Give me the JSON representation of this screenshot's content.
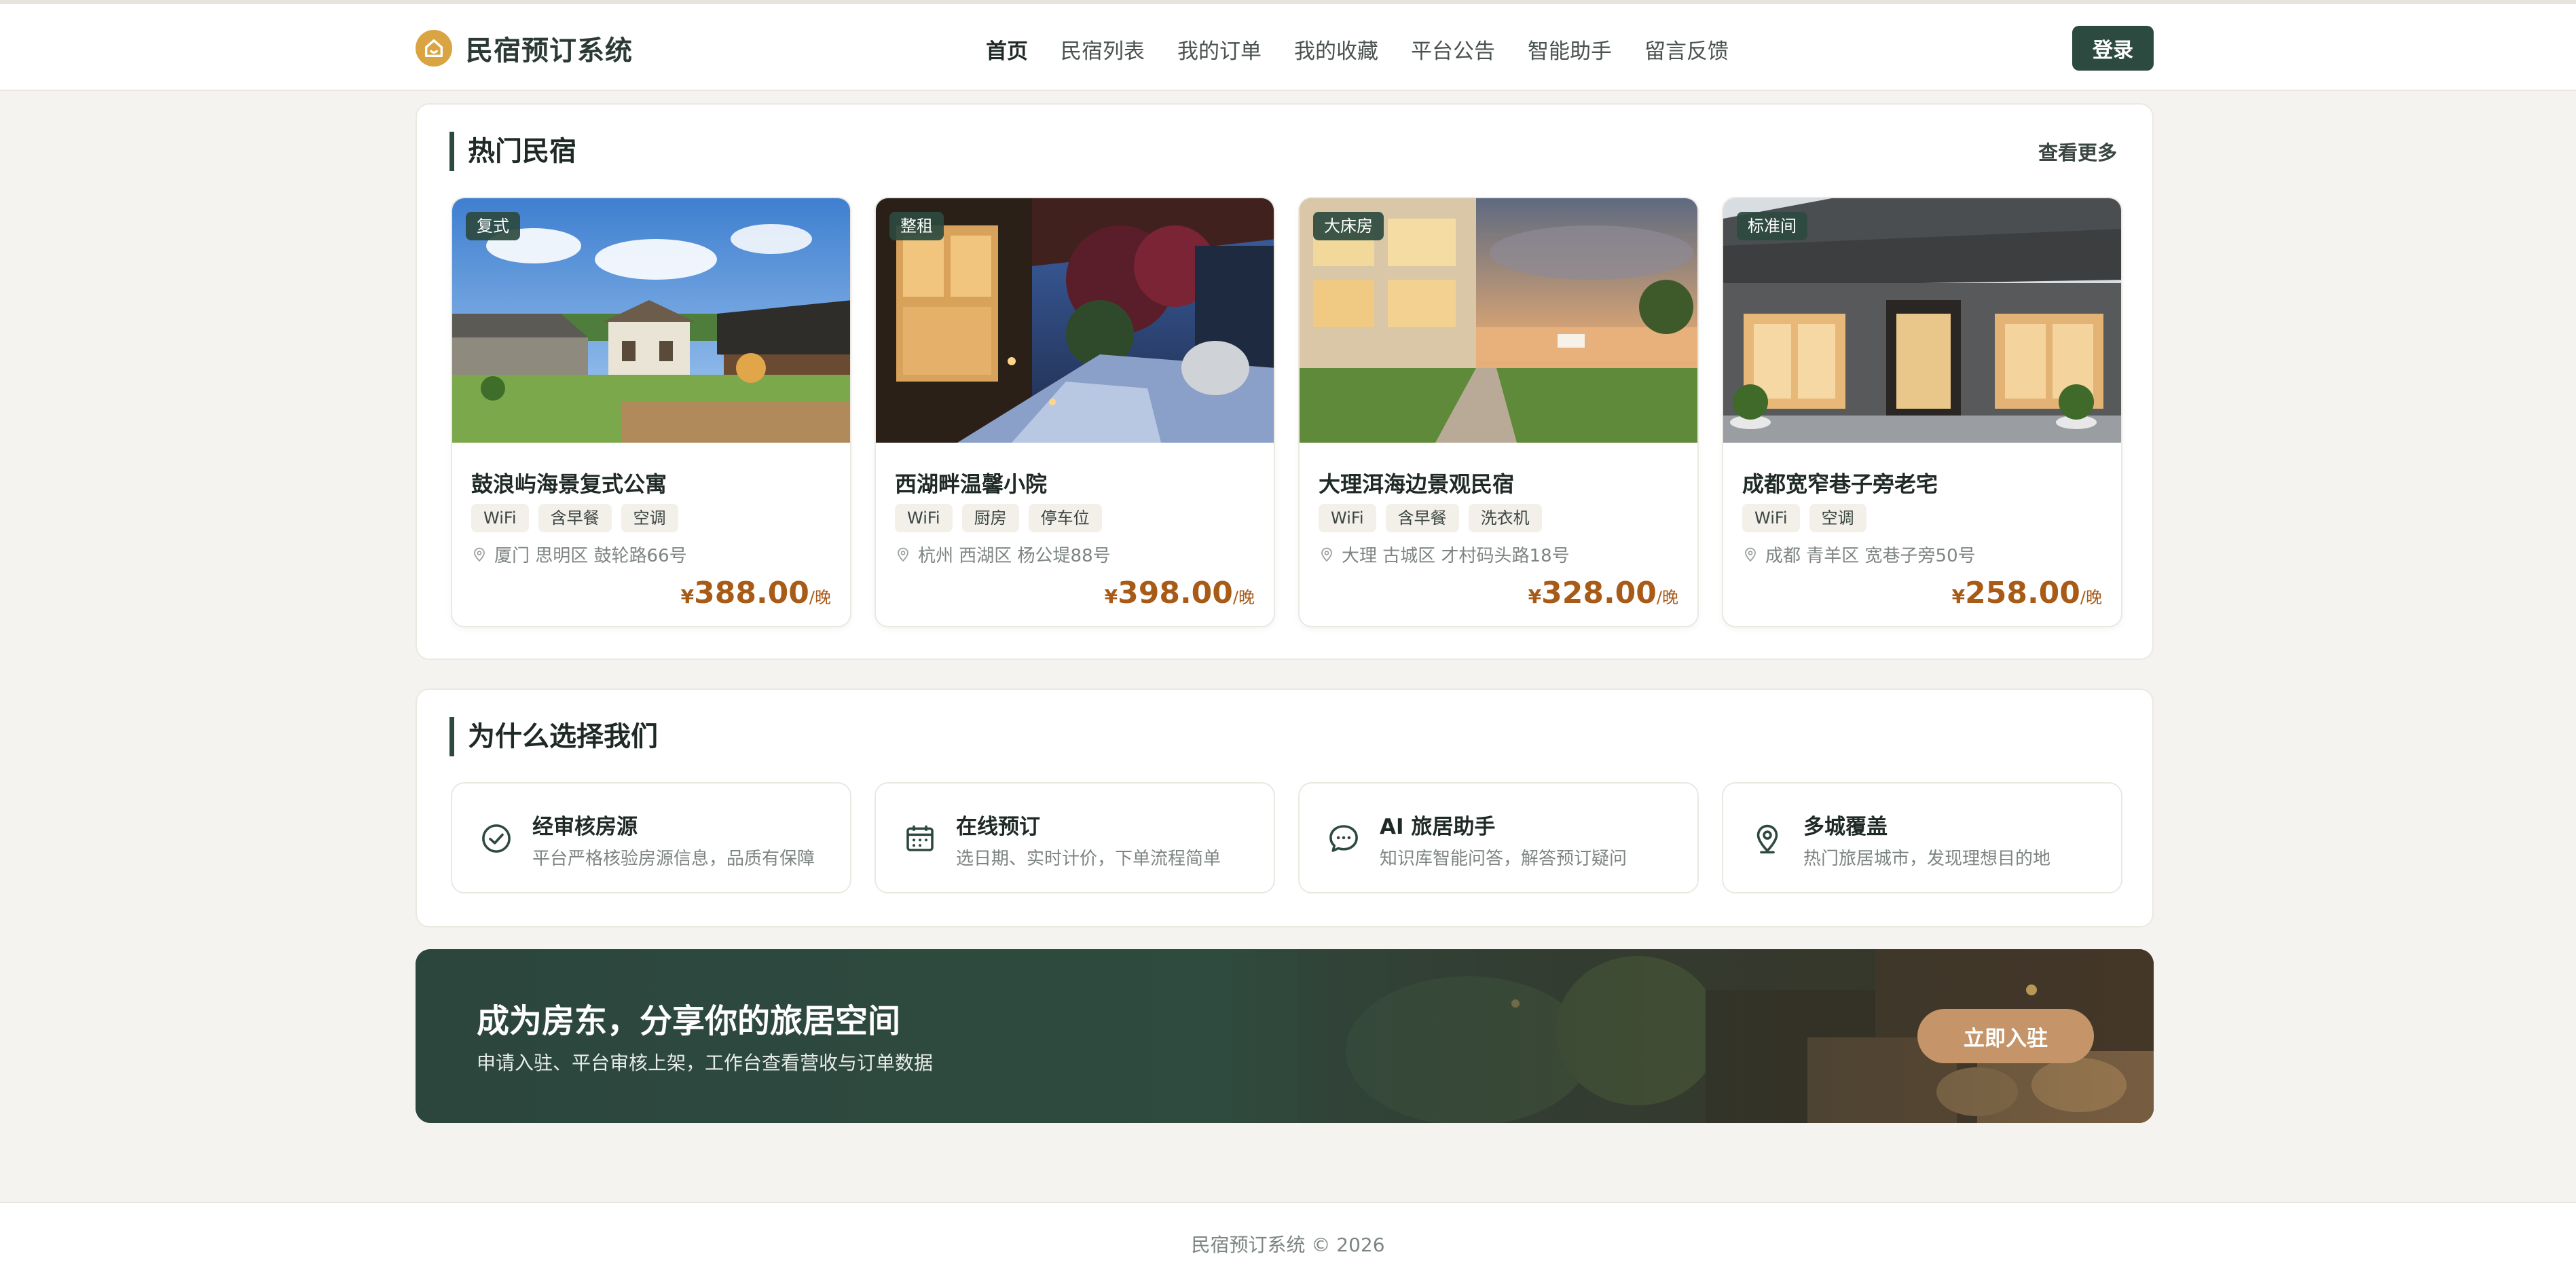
{
  "header": {
    "brand_name": "民宿预订系统",
    "nav": [
      "首页",
      "民宿列表",
      "我的订单",
      "我的收藏",
      "平台公告",
      "智能助手",
      "留言反馈"
    ],
    "active_nav": "首页",
    "login_label": "登录"
  },
  "hot": {
    "title": "热门民宿",
    "more_label": "查看更多",
    "cards": [
      {
        "badge": "复式",
        "name": "鼓浪屿海景复式公寓",
        "tags": [
          "WiFi",
          "含早餐",
          "空调"
        ],
        "address": "厦门 思明区 鼓轮路66号",
        "currency": "¥",
        "price": "388.00",
        "unit": "/晚"
      },
      {
        "badge": "整租",
        "name": "西湖畔温馨小院",
        "tags": [
          "WiFi",
          "厨房",
          "停车位"
        ],
        "address": "杭州 西湖区 杨公堤88号",
        "currency": "¥",
        "price": "398.00",
        "unit": "/晚"
      },
      {
        "badge": "大床房",
        "name": "大理洱海边景观民宿",
        "tags": [
          "WiFi",
          "含早餐",
          "洗衣机"
        ],
        "address": "大理 古城区 才村码头路18号",
        "currency": "¥",
        "price": "328.00",
        "unit": "/晚"
      },
      {
        "badge": "标准间",
        "name": "成都宽窄巷子旁老宅",
        "tags": [
          "WiFi",
          "空调"
        ],
        "address": "成都 青羊区 宽巷子旁50号",
        "currency": "¥",
        "price": "258.00",
        "unit": "/晚"
      }
    ]
  },
  "why": {
    "title": "为什么选择我们",
    "features": [
      {
        "icon": "check-circle-icon",
        "title": "经审核房源",
        "desc": "平台严格核验房源信息，品质有保障"
      },
      {
        "icon": "calendar-icon",
        "title": "在线预订",
        "desc": "选日期、实时计价，下单流程简单"
      },
      {
        "icon": "chat-bubble-icon",
        "title": "AI 旅居助手",
        "desc": "知识库智能问答，解答预订疑问"
      },
      {
        "icon": "map-pin-icon",
        "title": "多城覆盖",
        "desc": "热门旅居城市，发现理想目的地"
      }
    ]
  },
  "banner": {
    "title": "成为房东，分享你的旅居空间",
    "subtitle": "申请入驻、平台审核上架，工作台查看营收与订单数据",
    "cta_label": "立即入驻"
  },
  "footer": {
    "copyright": "民宿预订系统 © 2026"
  },
  "colors": {
    "primary": "#2d4a40",
    "price": "#a85a17",
    "accent": "#c59468",
    "logo": "#d9a441",
    "background": "#f5f3ef"
  }
}
